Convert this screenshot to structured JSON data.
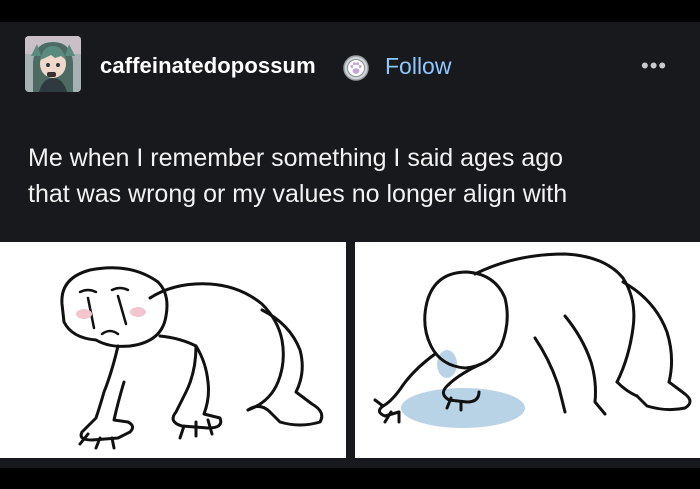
{
  "post": {
    "username": "caffeinatedopossum",
    "follow_label": "Follow",
    "more_label": "•••",
    "caption_line1": "Me when I remember something I said ages ago",
    "caption_line2": "that was wrong or my values no longer align with"
  },
  "icons": {
    "badge": "paw-badge-icon",
    "more": "more-options-icon"
  },
  "colors": {
    "background": "#17191c",
    "follow": "#8fc6ff",
    "text": "#f2f2f2"
  }
}
